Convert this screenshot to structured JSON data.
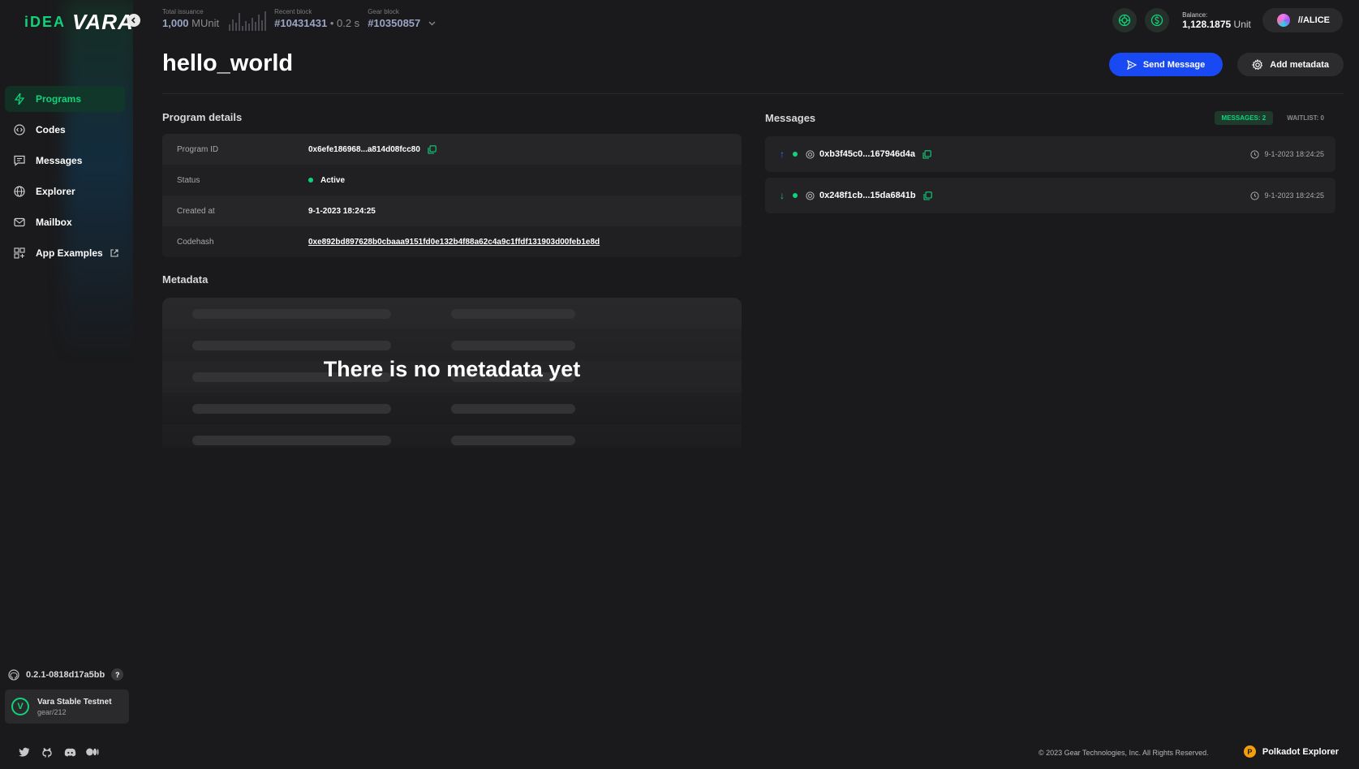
{
  "brand": {
    "idea": "iDEA",
    "vara": "VARA"
  },
  "header": {
    "issuance": {
      "label": "Total issuance",
      "value": "1,000",
      "unit": "MUnit"
    },
    "recent_block": {
      "label": "Recent block",
      "value": "#10431431",
      "time": "• 0.2 s"
    },
    "gear_block": {
      "label": "Gear block",
      "value": "#10350857"
    },
    "balance": {
      "label": "Balance:",
      "value": "1,128.1875",
      "unit": "Unit"
    },
    "account": "//ALICE"
  },
  "sidebar": {
    "items": [
      {
        "label": "Programs",
        "icon": "lightning-icon",
        "active": true
      },
      {
        "label": "Codes",
        "icon": "code-icon"
      },
      {
        "label": "Messages",
        "icon": "message-icon"
      },
      {
        "label": "Explorer",
        "icon": "globe-icon"
      },
      {
        "label": "Mailbox",
        "icon": "mail-icon"
      },
      {
        "label": "App Examples",
        "icon": "apps-icon"
      }
    ],
    "version": "0.2.1-0818d17a5bb",
    "help": "?",
    "network": {
      "name": "Vara Stable Testnet",
      "sub": "gear/212"
    }
  },
  "page": {
    "title": "hello_world",
    "send_message": "Send Message",
    "add_metadata": "Add metadata"
  },
  "program_details": {
    "title": "Program details",
    "rows": [
      {
        "label": "Program ID",
        "value": "0x6efe186968...a814d08fcc80"
      },
      {
        "label": "Status",
        "value": "Active"
      },
      {
        "label": "Created at",
        "value": "9-1-2023 18:24:25"
      },
      {
        "label": "Codehash",
        "value": "0xe892bd897628b0cbaaa9151fd0e132b4f88a62c4a9c1ffdf131903d00feb1e8d"
      }
    ]
  },
  "metadata": {
    "title": "Metadata",
    "empty": "There is no metadata yet"
  },
  "messages": {
    "title": "Messages",
    "count_badge": "MESSAGES: 2",
    "waitlist_badge": "WAITLIST: 0",
    "items": [
      {
        "direction": "↑",
        "id": "0xb3f45c0...167946d4a",
        "time": "9-1-2023 18:24:25"
      },
      {
        "direction": "↓",
        "id": "0x248f1cb...15da6841b",
        "time": "9-1-2023 18:24:25"
      }
    ]
  },
  "footer": {
    "copyright": "© 2023 Gear Technologies, Inc. All Rights Reserved.",
    "explorer": "Polkadot Explorer"
  },
  "colors": {
    "accent": "#0fd37b",
    "primary_button": "#1849f3",
    "background": "#1a1a1c"
  }
}
